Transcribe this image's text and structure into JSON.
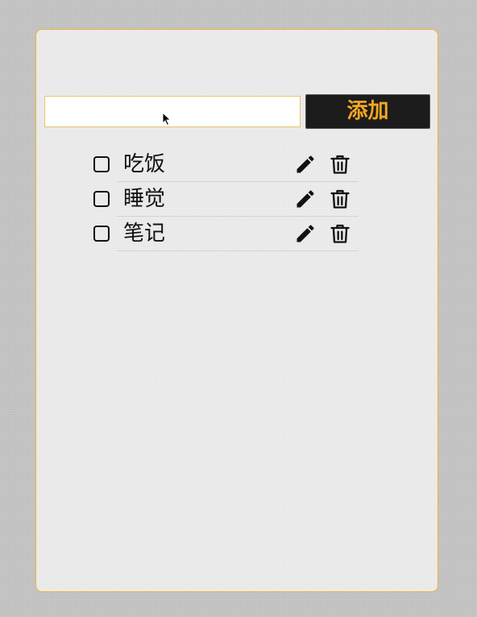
{
  "form": {
    "input_value": "",
    "input_placeholder": "",
    "add_label": "添加"
  },
  "todos": [
    {
      "text": "吃饭",
      "checked": false,
      "edit_icon": "pencil-icon",
      "delete_icon": "trash-icon"
    },
    {
      "text": "睡觉",
      "checked": false,
      "edit_icon": "pencil-icon",
      "delete_icon": "trash-icon"
    },
    {
      "text": "笔记",
      "checked": false,
      "edit_icon": "pencil-icon",
      "delete_icon": "trash-icon"
    }
  ],
  "colors": {
    "accent": "#f5a623",
    "card_border": "#f0b429",
    "button_bg": "#1c1c1c"
  }
}
